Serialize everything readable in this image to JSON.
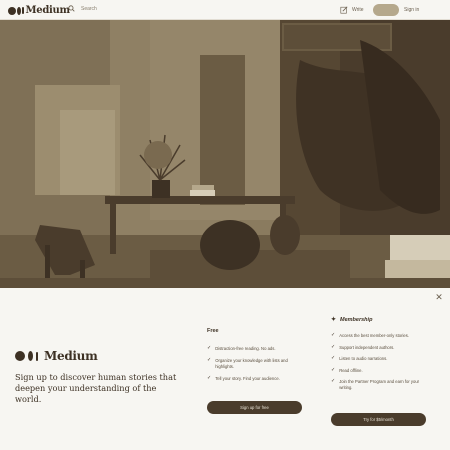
{
  "topbar": {
    "logo_text": "Medium",
    "search_placeholder": "Search",
    "write_label": "Write",
    "signup_label": "",
    "signin_label": "Sign in"
  },
  "hero": {
    "icon": "interior-photo"
  },
  "modal": {
    "close_icon": "close-icon",
    "brand_text": "Medium",
    "tagline": "Sign up to discover human stories that deepen your understanding of the world.",
    "free": {
      "title": "Free",
      "features": [
        "Distraction-free reading. No ads.",
        "Organize your knowledge with lists and highlights.",
        "Tell your story. Find your audience."
      ],
      "button_label": "Sign up for free"
    },
    "membership": {
      "title": "Membership",
      "features": [
        "Access the best member-only stories.",
        "Support independent authors.",
        "Listen to audio narrations.",
        "Read offline.",
        "Join the Partner Program and earn for your writing."
      ],
      "button_label": "Try for $5/month"
    }
  },
  "colors": {
    "primary": "#4a3c2c",
    "background": "#f7f6f2",
    "pill": "#b5a88c"
  }
}
